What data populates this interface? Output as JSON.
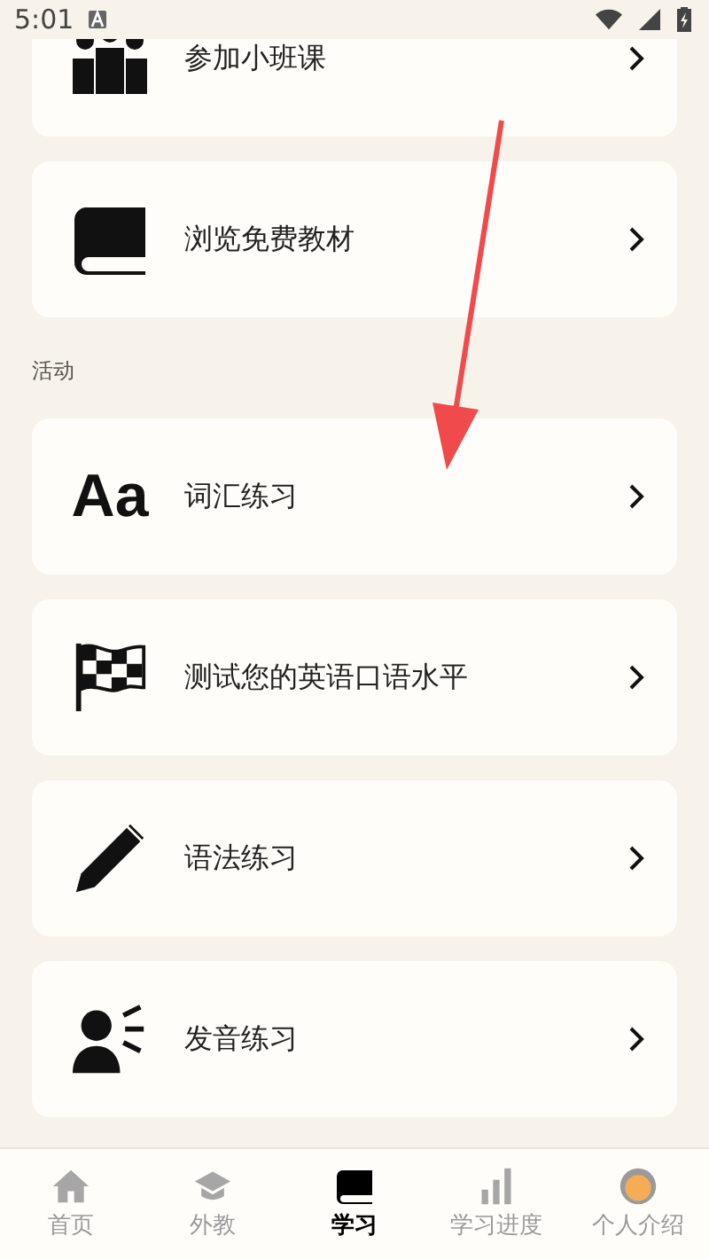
{
  "status_bar": {
    "time": "5:01"
  },
  "top_items": [
    {
      "kind": "people",
      "label": "参加小班课"
    },
    {
      "kind": "book",
      "label": "浏览免费教材"
    }
  ],
  "section": {
    "title": "活动"
  },
  "items": [
    {
      "kind": "letters",
      "glyph": "Aa",
      "label": "词汇练习"
    },
    {
      "kind": "flag",
      "label": "测试您的英语口语水平"
    },
    {
      "kind": "pencil",
      "label": "语法练习"
    },
    {
      "kind": "speaker",
      "label": "发音练习"
    }
  ],
  "tabs": [
    {
      "kind": "home",
      "label": "首页",
      "selected": false
    },
    {
      "kind": "cap",
      "label": "外教",
      "selected": false
    },
    {
      "kind": "book",
      "label": "学习",
      "selected": true
    },
    {
      "kind": "bars",
      "label": "学习进度",
      "selected": false
    },
    {
      "kind": "avatar",
      "label": "个人介绍",
      "selected": false
    }
  ],
  "annotation": {
    "kind": "arrow"
  }
}
